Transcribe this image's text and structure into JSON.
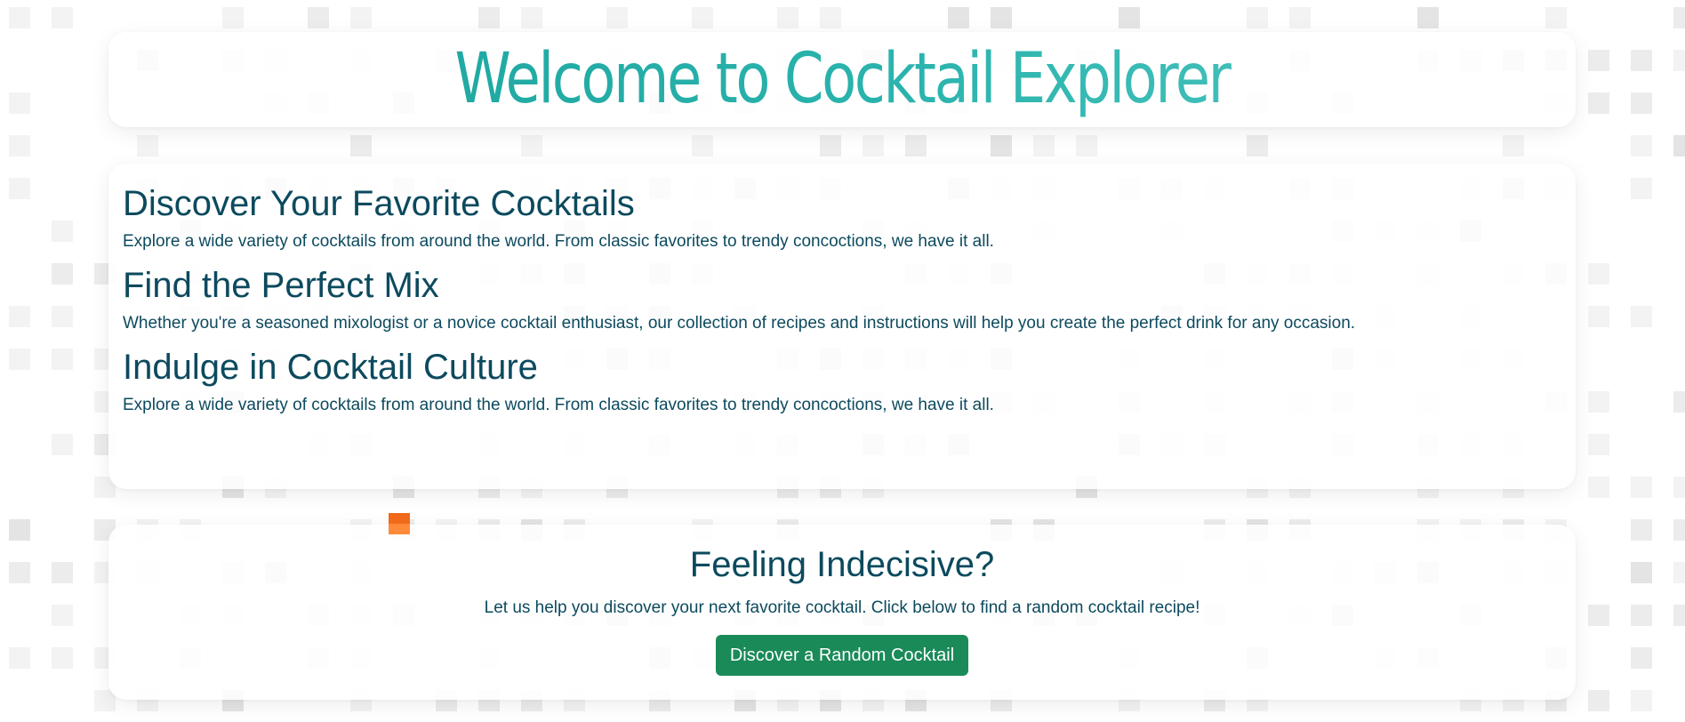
{
  "hero": {
    "title": "Welcome to Cocktail Explorer"
  },
  "info": {
    "sections": [
      {
        "heading": "Discover Your Favorite Cocktails",
        "text": "Explore a wide variety of cocktails from around the world. From classic favorites to trendy concoctions, we have it all."
      },
      {
        "heading": "Find the Perfect Mix",
        "text": "Whether you're a seasoned mixologist or a novice cocktail enthusiast, our collection of recipes and instructions will help you create the perfect drink for any occasion."
      },
      {
        "heading": "Indulge in Cocktail Culture",
        "text": "Explore a wide variety of cocktails from around the world. From classic favorites to trendy concoctions, we have it all."
      }
    ]
  },
  "cta": {
    "heading": "Feeling Indecisive?",
    "text": "Let us help you discover your next favorite cocktail. Click below to find a random cocktail recipe!",
    "button_label": "Discover a Random Cocktail"
  },
  "colors": {
    "heading_text": "#0c4a5e",
    "title_gradient_start": "#1aa59e",
    "title_gradient_end": "#4cc5bf",
    "button_bg": "#1a8a58",
    "accent_square": "#f06a1a"
  }
}
